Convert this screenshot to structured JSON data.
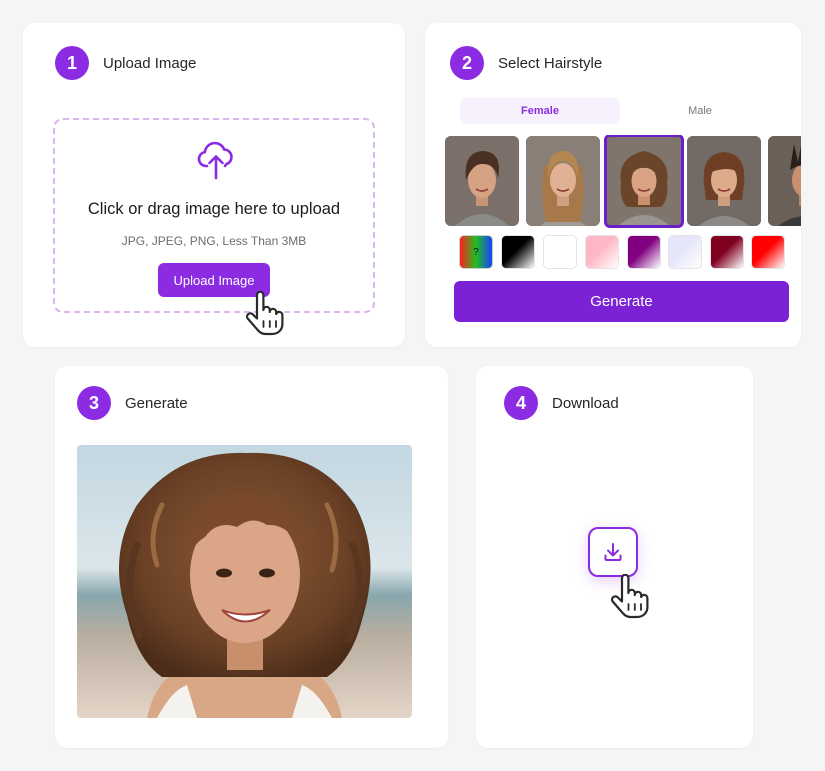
{
  "steps": [
    {
      "number": "1",
      "title": "Upload Image"
    },
    {
      "number": "2",
      "title": "Select Hairstyle"
    },
    {
      "number": "3",
      "title": "Generate"
    },
    {
      "number": "4",
      "title": "Download"
    }
  ],
  "upload": {
    "title": "Click or drag image here to upload",
    "subtitle": "JPG, JPEG, PNG, Less Than 3MB",
    "button_label": "Upload Image",
    "icon": "cloud-upload-icon"
  },
  "hairstyle": {
    "tabs": [
      {
        "label": "Female",
        "active": true
      },
      {
        "label": "Male",
        "active": false
      }
    ],
    "thumbnails": [
      {
        "style": "pixie-cut",
        "selected": false
      },
      {
        "style": "long-wavy",
        "selected": false
      },
      {
        "style": "curly-bob-with-bangs",
        "selected": true
      },
      {
        "style": "straight-bob",
        "selected": false
      },
      {
        "style": "spiky",
        "selected": false
      }
    ],
    "color_swatches": [
      {
        "name": "random",
        "label": "?",
        "colors": [
          "#ff2020",
          "#20c020",
          "#1a40ff"
        ]
      },
      {
        "name": "black",
        "colors": [
          "#000000",
          "#ffffff"
        ]
      },
      {
        "name": "white",
        "colors": [
          "#ffffff",
          "#ffffff"
        ]
      },
      {
        "name": "pink",
        "colors": [
          "#ffb7c5",
          "#ffffff"
        ]
      },
      {
        "name": "purple",
        "colors": [
          "#800080",
          "#ffffff"
        ]
      },
      {
        "name": "lavender",
        "colors": [
          "#e6e6fa",
          "#ffffff"
        ]
      },
      {
        "name": "burgundy",
        "colors": [
          "#800020",
          "#ffffff"
        ]
      },
      {
        "name": "red",
        "colors": [
          "#ff0000",
          "#ffffff"
        ]
      }
    ],
    "generate_label": "Generate"
  },
  "download": {
    "icon": "download-icon"
  },
  "colors": {
    "accent": "#8b2be2",
    "accent_dark": "#7b21d6",
    "background": "#f5f5f6",
    "card": "#ffffff"
  }
}
